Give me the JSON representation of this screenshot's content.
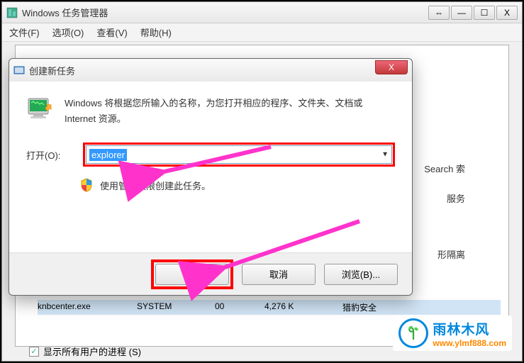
{
  "mainWindow": {
    "title": "Windows 任务管理器",
    "controls": {
      "restore": "⇔",
      "minimize": "—",
      "maximize": "☐",
      "close": "X"
    }
  },
  "menu": {
    "file": "文件(F)",
    "options": "选项(O)",
    "view": "查看(V)",
    "help": "帮助(H)"
  },
  "bgText": {
    "search": "Search 索",
    "service": "服务",
    "isolation": "形隔离"
  },
  "bgList": {
    "row1": {
      "name": "knbcenter.exe",
      "user": "SYSTEM",
      "cpu": "00",
      "mem": "4,276 K",
      "desc": "猎豹安全"
    }
  },
  "checkbox": {
    "label": "显示所有用户的进程 (S)",
    "checked": "✓"
  },
  "dialog": {
    "title": "创建新任务",
    "close": "X",
    "description": "Windows 将根据您所输入的名称，为您打开相应的程序、文件夹、文档或 Internet 资源。",
    "openLabel": "打开(O):",
    "inputValue": "explorer",
    "adminText": "使用管理权限创建此任务。",
    "buttons": {
      "ok": "确定",
      "cancel": "取消",
      "browse": "浏览(B)..."
    }
  },
  "watermark": {
    "cn": "雨林木风",
    "url": "www.ylmf888.com"
  }
}
